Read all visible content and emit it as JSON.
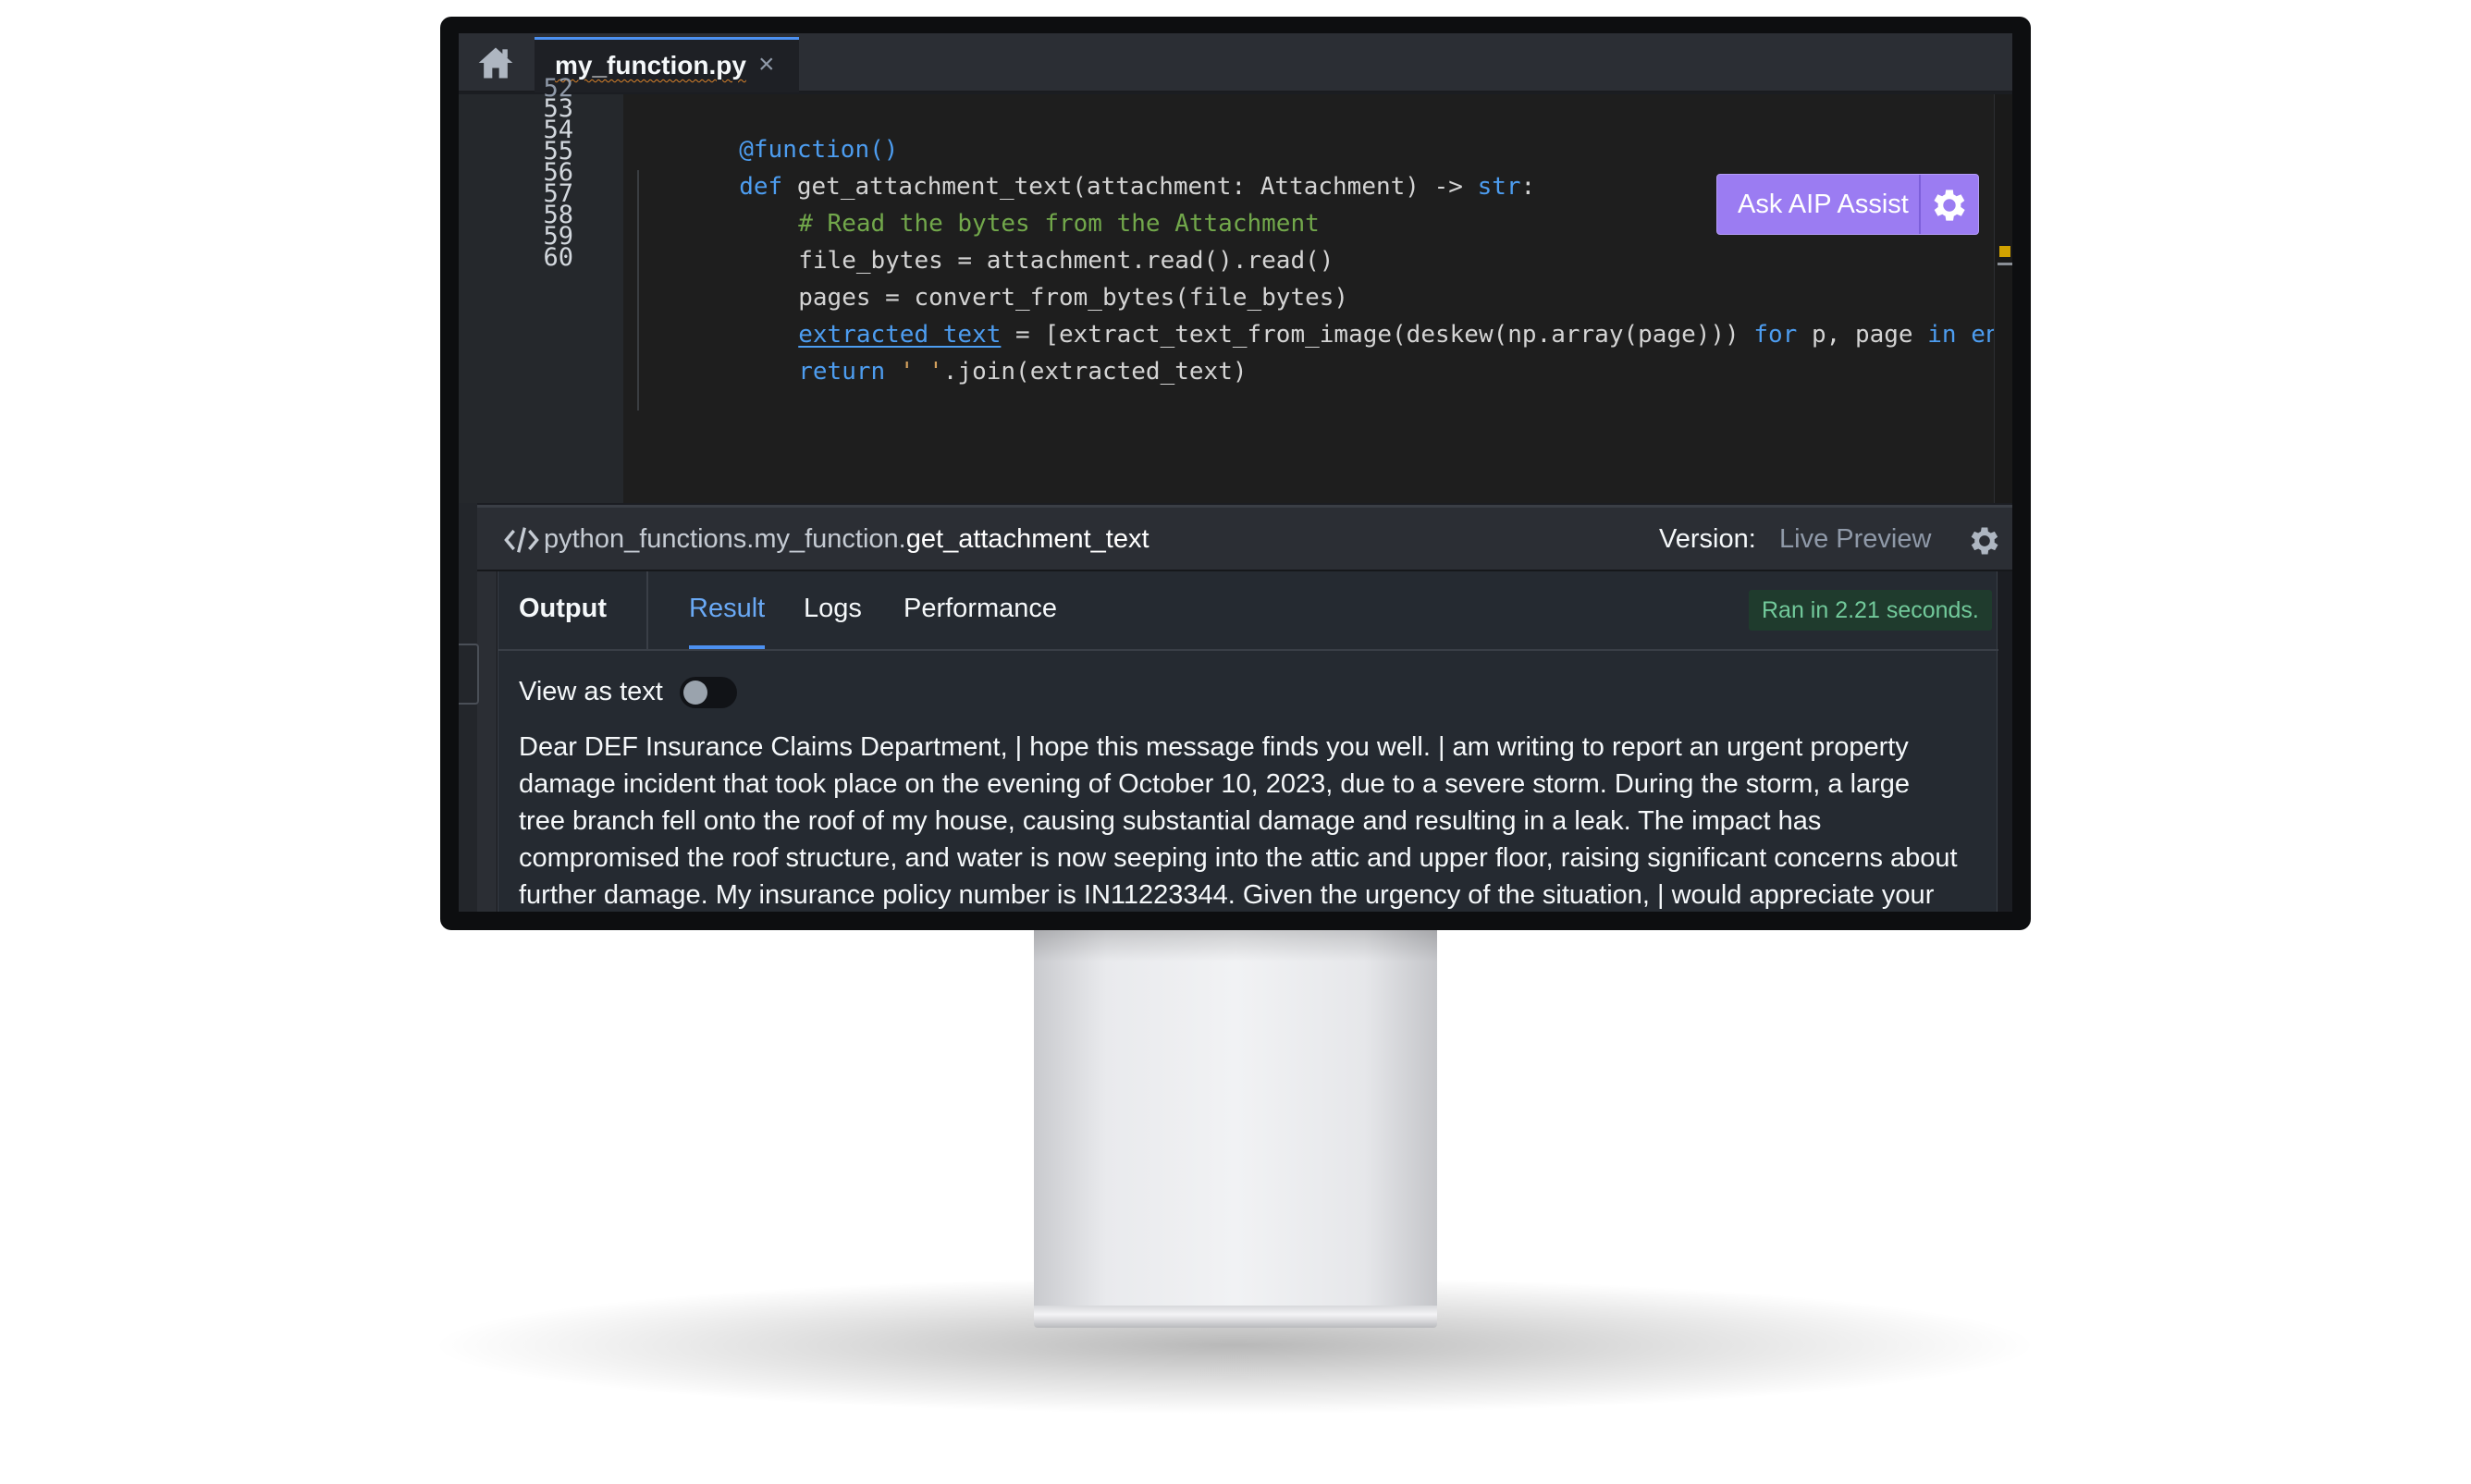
{
  "tab": {
    "filename": "my_function.py",
    "close_glyph": "×"
  },
  "editor": {
    "partial_line_number": "52",
    "line_numbers": [
      "53",
      "54",
      "55",
      "56",
      "57",
      "58",
      "59",
      "60"
    ],
    "code": {
      "l53_decorator": "@function()",
      "l54_kw": "def",
      "l54_sig": " get_attachment_text(attachment: Attachment) -> ",
      "l54_type": "str",
      "l54_end": ":",
      "l55_comment": "# Read the bytes from the Attachment",
      "l56": "file_bytes = attachment.read().read()",
      "l57": "pages = convert_from_bytes(file_bytes)",
      "l58_var": "extracted_text",
      "l58_mid": " = [extract_text_from_image(deskew(np.array(page))) ",
      "l58_for": "for",
      "l58_vars": " p, page ",
      "l58_in": "in",
      "l58_tail": " enumerate",
      "l59_kw": "return",
      "l59_str": "' '",
      "l59_rest": ".join(extracted_text)"
    },
    "aip_button_label": "Ask AIP Assist"
  },
  "preview": {
    "path_prefix": "python_functions.my_function.",
    "function_name": "get_attachment_text",
    "version_label": "Version:",
    "version_value": "Live Preview"
  },
  "output": {
    "section_label": "Output",
    "tabs": {
      "result": "Result",
      "logs": "Logs",
      "performance": "Performance"
    },
    "ran_badge": "Ran in 2.21 seconds.",
    "view_as_text_label": "View as text",
    "view_as_text_enabled": false,
    "result_text": "Dear DEF Insurance Claims Department, | hope this message finds you well. | am writing to report an urgent property damage incident that took place on the evening of October 10, 2023, due to a severe storm. During the storm, a large tree branch fell onto the roof of my house, causing substantial damage and resulting in a leak. The impact has compromised the roof structure, and water is now seeping into the attic and upper floor, raising significant concerns about further damage. My insurance policy number is IN11223344. Given the urgency of the situation, | would appreciate your"
  },
  "icons": {
    "home": "home-icon",
    "close": "close-icon",
    "aip_settings": "gear-icon",
    "function": "code-icon",
    "preview_settings": "gear-icon"
  },
  "colors": {
    "accent_blue": "#4c90f0",
    "aip_purple": "#9b7cf2",
    "success_green": "#72ca9b",
    "editor_bg": "#1e1e1e"
  }
}
